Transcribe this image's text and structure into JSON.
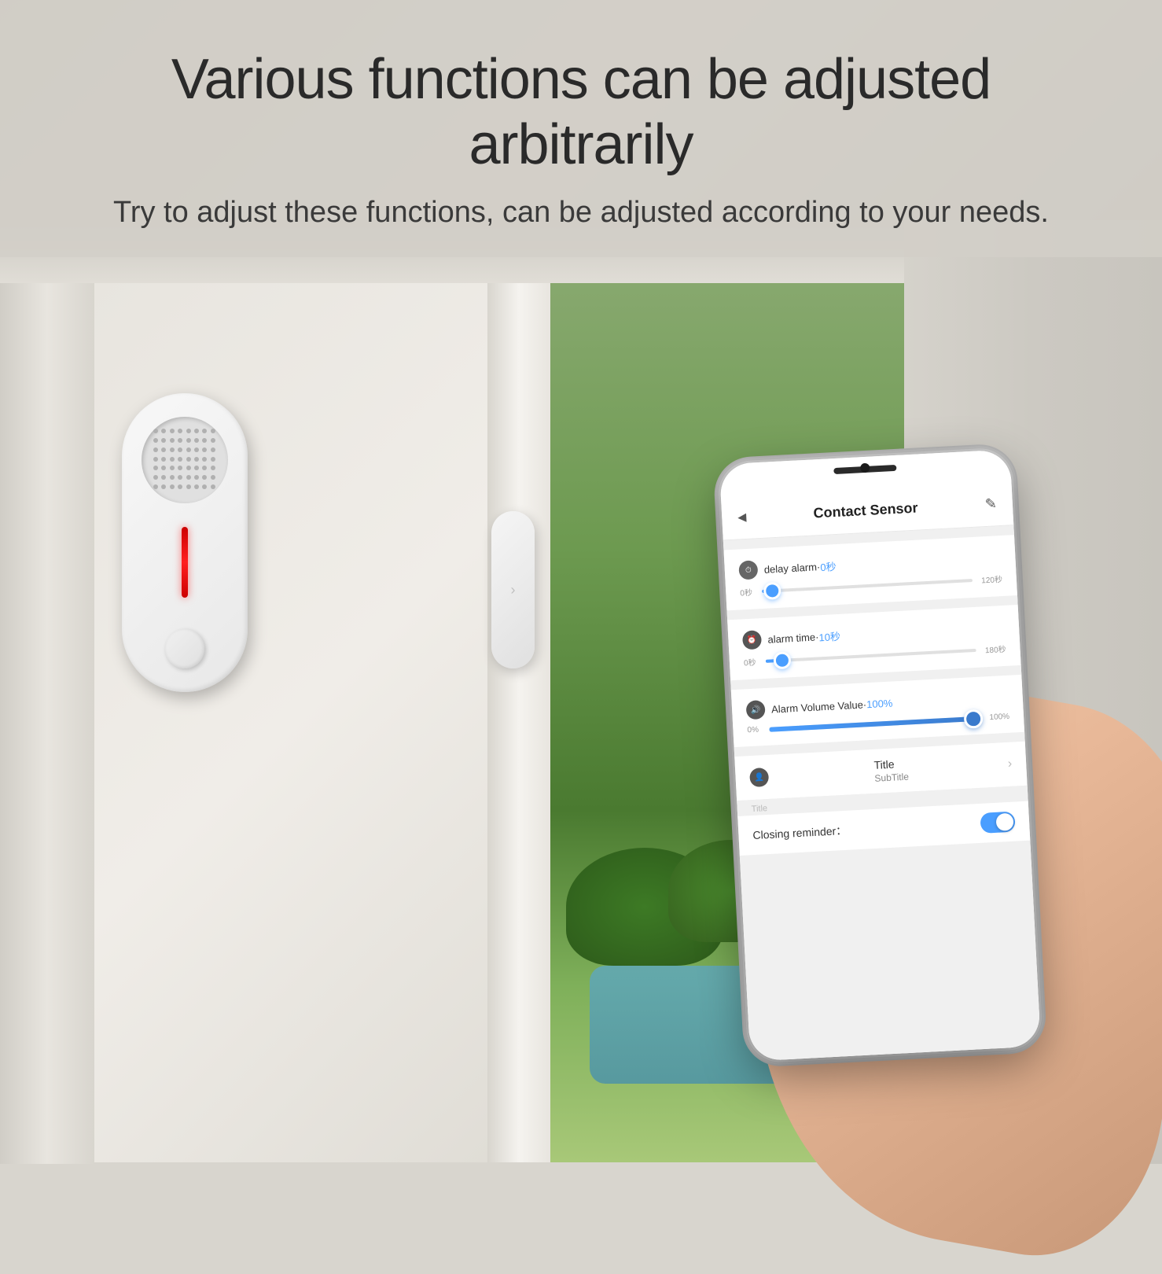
{
  "page": {
    "main_title": "Various functions can be adjusted arbitrarily",
    "sub_title": "Try to adjust these functions, can be adjusted according to your needs."
  },
  "app": {
    "header": {
      "back_icon": "◂",
      "title": "Contact Sensor",
      "edit_icon": "✎"
    },
    "settings": {
      "delay_alarm": {
        "icon": "⏱",
        "label": "delay alarm",
        "separator": " · ",
        "value": "0秒",
        "slider_min": "0秒",
        "slider_max": "120秒",
        "slider_percent": 5
      },
      "alarm_time": {
        "icon": "⏰",
        "label": "alarm time",
        "separator": " · ",
        "value": "10秒",
        "slider_min": "0秒",
        "slider_max": "180秒",
        "slider_percent": 8
      },
      "alarm_volume": {
        "icon": "🔊",
        "label": "Alarm Volume Value",
        "separator": " · ",
        "value": "100%",
        "slider_min": "0%",
        "slider_max": "100%",
        "slider_percent": 100
      },
      "title_nav": {
        "title": "Title",
        "subtitle": "SubTitle"
      },
      "title_label": "Title",
      "closing_reminder": {
        "label": "Closing reminder：",
        "enabled": true
      }
    }
  }
}
